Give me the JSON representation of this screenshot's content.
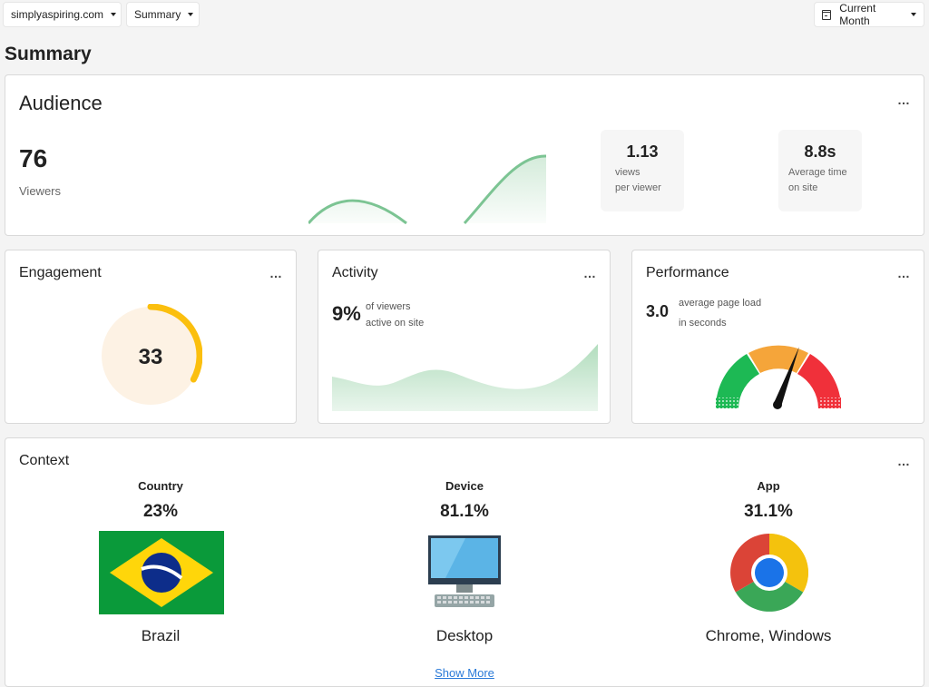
{
  "toolbar": {
    "site": "simplyaspiring.com",
    "view": "Summary",
    "period": "Current Month"
  },
  "page": {
    "title": "Summary"
  },
  "audience": {
    "title": "Audience",
    "viewers_value": "76",
    "viewers_label": "Viewers",
    "views_per_viewer_value": "1.13",
    "views_per_viewer_label_1": "views",
    "views_per_viewer_label_2": "per viewer",
    "avg_time_value": "8.8s",
    "avg_time_label_1": "Average time",
    "avg_time_label_2": "on site"
  },
  "engagement": {
    "title": "Engagement",
    "score": "33",
    "score_fraction": 0.33,
    "colors": {
      "ring": "#fbbf0e",
      "fill": "#fdf2e4"
    }
  },
  "activity": {
    "title": "Activity",
    "percent": "9%",
    "label_1": "of viewers",
    "label_2": "active on site"
  },
  "performance": {
    "title": "Performance",
    "value": "3.0",
    "label_1": "average page load",
    "label_2": "in seconds",
    "colors": {
      "good": "#1db954",
      "mid": "#f5a53a",
      "bad": "#f0303a"
    }
  },
  "context": {
    "title": "Context",
    "columns": [
      {
        "heading": "Country",
        "percent": "23%",
        "name": "Brazil",
        "icon": "brazil-flag-icon"
      },
      {
        "heading": "Device",
        "percent": "81.1%",
        "name": "Desktop",
        "icon": "desktop-icon"
      },
      {
        "heading": "App",
        "percent": "31.1%",
        "name": "Chrome, Windows",
        "icon": "chrome-icon"
      }
    ],
    "show_more": "Show More"
  },
  "more_menu": "…"
}
